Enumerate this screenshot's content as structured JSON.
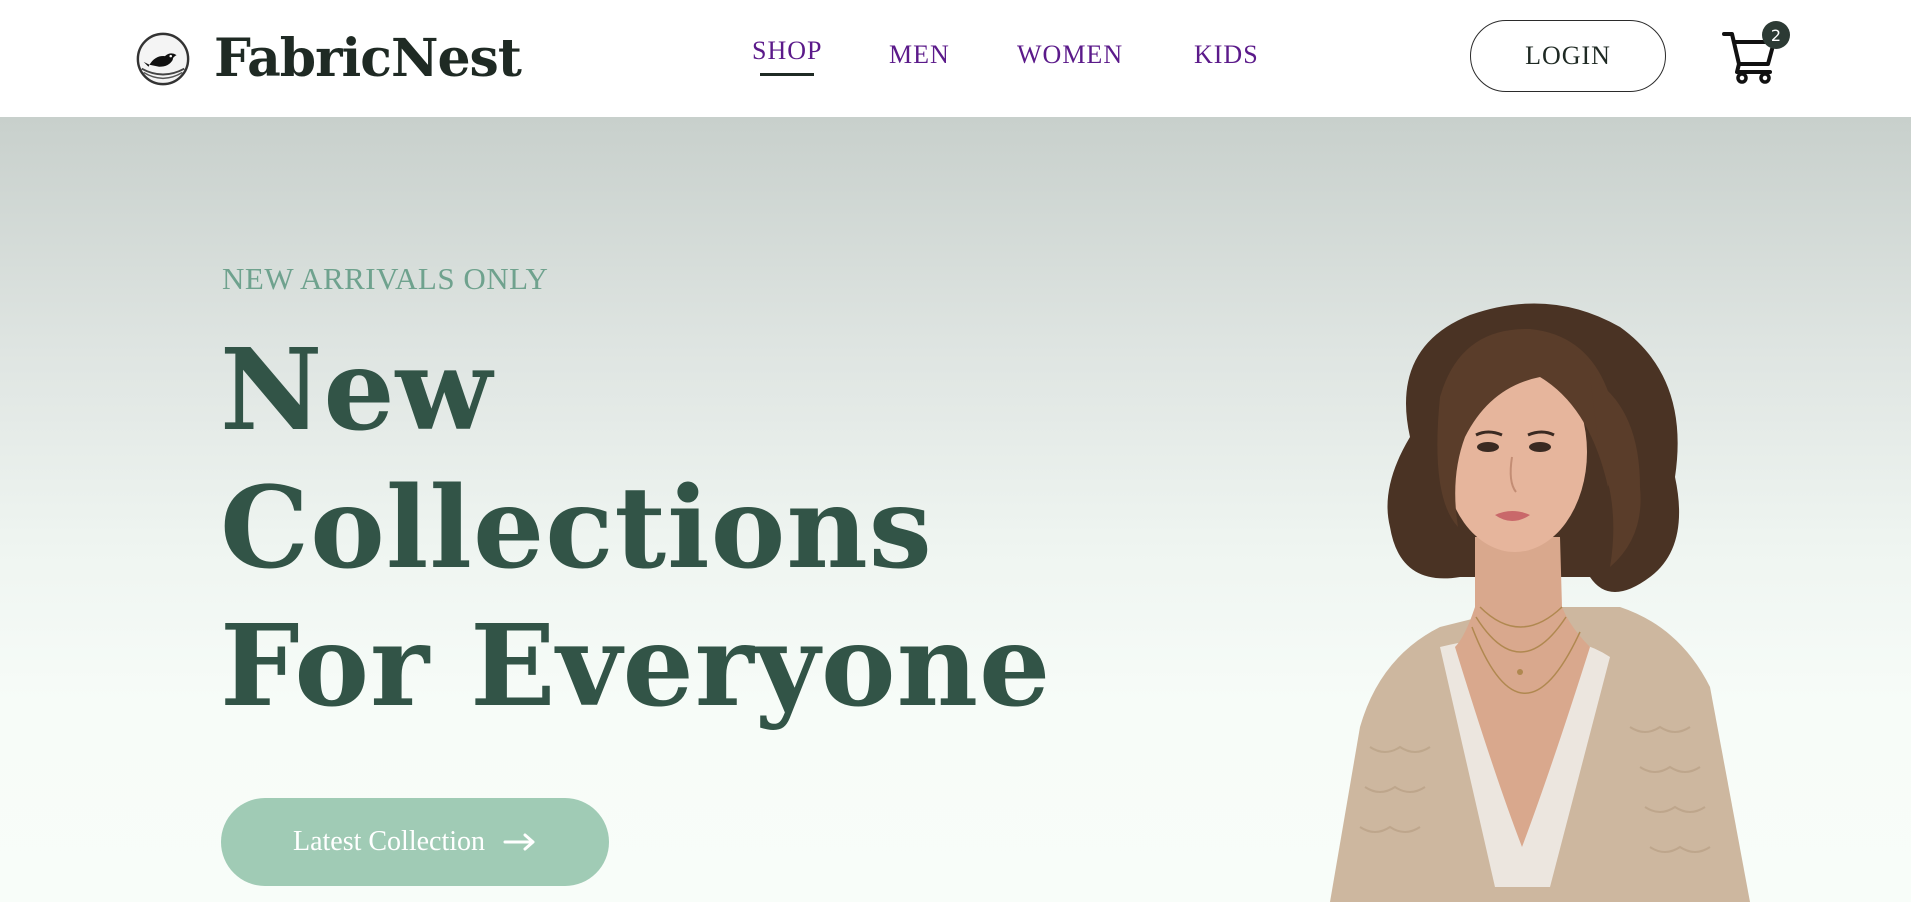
{
  "brand": {
    "name": "FabricNest",
    "logo_icon": "bird-nest-icon"
  },
  "nav": {
    "items": [
      {
        "label": "SHOP",
        "active": true
      },
      {
        "label": "MEN",
        "active": false
      },
      {
        "label": "WOMEN",
        "active": false
      },
      {
        "label": "KIDS",
        "active": false
      }
    ]
  },
  "header": {
    "login_label": "LOGIN",
    "cart_icon": "shopping-cart-icon",
    "cart_count": "2"
  },
  "hero": {
    "eyebrow": "NEW ARRIVALS ONLY",
    "headline_lines": [
      "New",
      "Collections",
      "For Everyone"
    ],
    "cta_label": "Latest Collection",
    "cta_icon": "arrow-right-icon",
    "image": "model-portrait-image"
  },
  "colors": {
    "nav_link": "#5b1a8a",
    "headline": "#325447",
    "eyebrow": "#6fa28e",
    "cta_bg": "#a0cbb5",
    "badge_bg": "#2c3a34"
  }
}
